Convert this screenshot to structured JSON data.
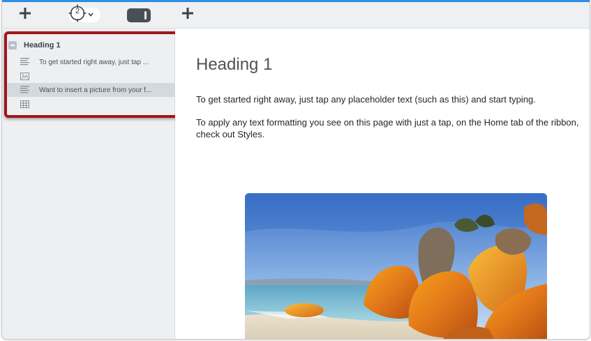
{
  "toolbar": {
    "add_left_icon": "plus-icon",
    "navigator_page": "2",
    "navigator_icon": "target-icon",
    "chevron_icon": "chevron-down-icon",
    "toggle_icon": "sidebar-toggle-icon",
    "add_right_icon": "plus-icon"
  },
  "outline": {
    "heading_label": "Heading 1",
    "items": [
      {
        "type": "paragraph",
        "icon": "paragraph-icon",
        "text": "To get started right  away, just tap ..."
      },
      {
        "type": "image",
        "icon": "image-icon",
        "text": ""
      },
      {
        "type": "paragraph",
        "icon": "paragraph-icon",
        "text": "Want to insert a  picture from your f...",
        "selected": true
      },
      {
        "type": "table",
        "icon": "table-icon",
        "text": ""
      }
    ]
  },
  "document": {
    "heading": "Heading 1",
    "paragraph1": "To get started right  away, just tap any placeholder text (such as this) and start typing.",
    "paragraph2": "To apply any text  formatting you see on this page with just a tap, on the Home tab of the ribbon, check out Styles.",
    "image_icon": "beach-photo"
  },
  "colors": {
    "accent": "#2f8de4",
    "highlight_frame": "#a2151c",
    "selected_row": "#d3d9de"
  }
}
